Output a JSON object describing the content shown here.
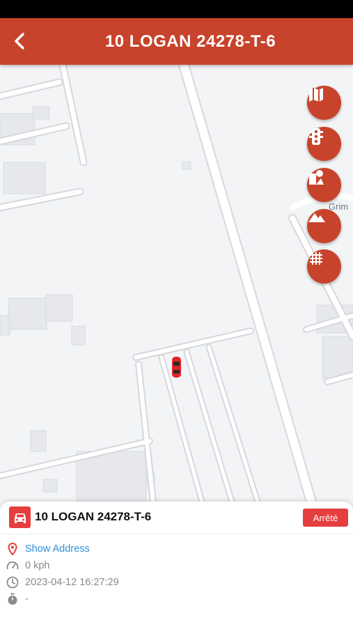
{
  "header": {
    "title": "10 LOGAN 24278-T-6"
  },
  "map": {
    "poi_label": "Grim",
    "controls": [
      {
        "name": "map-layer-icon"
      },
      {
        "name": "traffic-light-icon"
      },
      {
        "name": "poi-icon"
      },
      {
        "name": "terrain-icon"
      },
      {
        "name": "grid-icon"
      }
    ]
  },
  "vehicle": {
    "name": "10 LOGAN 24278-T-6",
    "status": "Arrêté",
    "address_link": "Show Address",
    "speed": "0 kph",
    "timestamp": "2023-04-12 16:27:29",
    "duration": "-"
  },
  "colors": {
    "brand": "#c8432b",
    "status": "#e63e3e",
    "link": "#2f8fd8"
  }
}
